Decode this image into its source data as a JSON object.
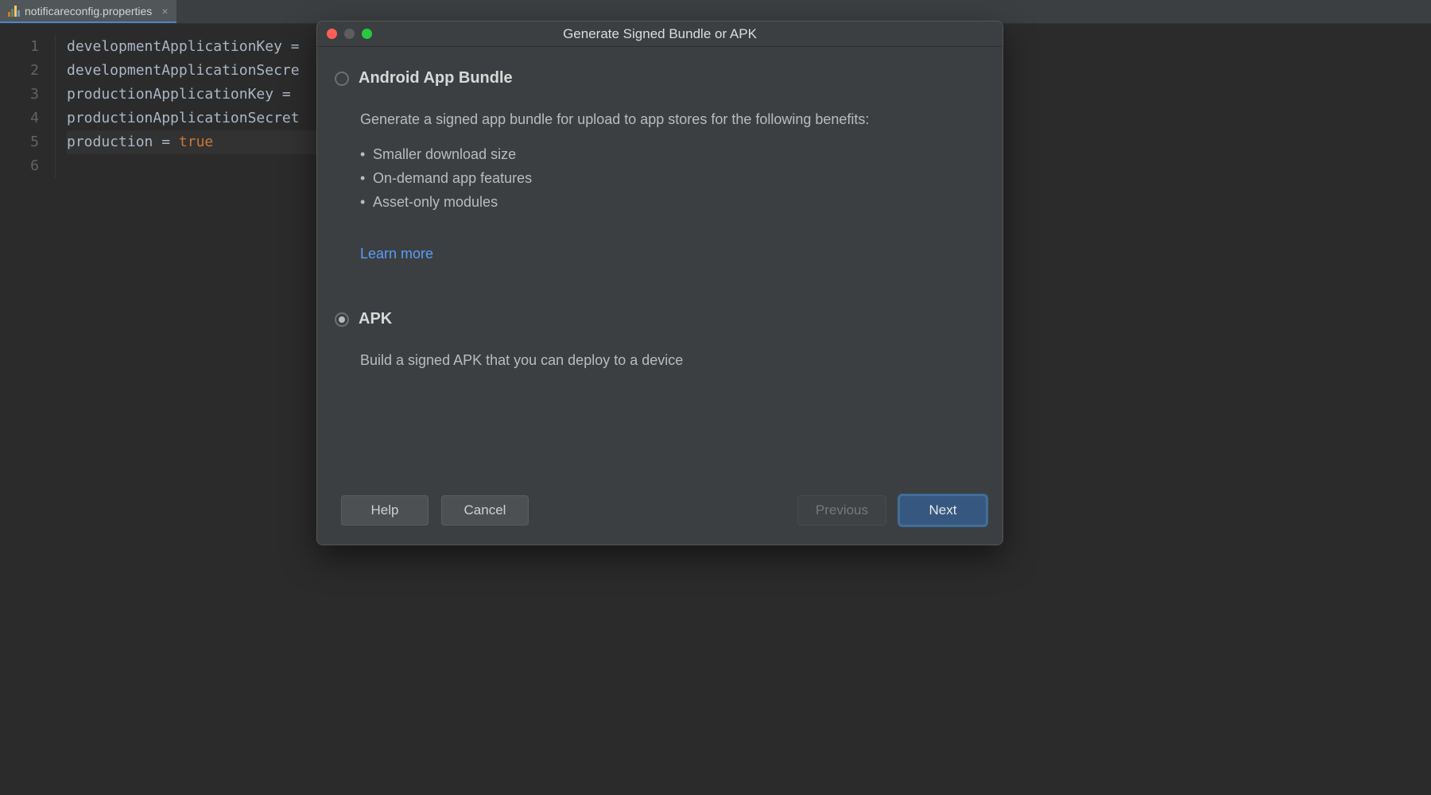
{
  "tab": {
    "filename": "notificareconfig.properties"
  },
  "editor": {
    "lines": [
      "developmentApplicationKey =",
      "developmentApplicationSecre",
      "productionApplicationKey =",
      "productionApplicationSecret",
      "production = ",
      ""
    ],
    "line5_value": "true",
    "line_numbers": [
      "1",
      "2",
      "3",
      "4",
      "5",
      "6"
    ]
  },
  "dialog": {
    "title": "Generate Signed Bundle or APK",
    "option_bundle": {
      "label": "Android App Bundle",
      "description": "Generate a signed app bundle for upload to app stores for the following benefits:",
      "bullets": [
        "Smaller download size",
        "On-demand app features",
        "Asset-only modules"
      ],
      "link": "Learn more"
    },
    "option_apk": {
      "label": "APK",
      "description": "Build a signed APK that you can deploy to a device"
    },
    "buttons": {
      "help": "Help",
      "cancel": "Cancel",
      "previous": "Previous",
      "next": "Next"
    }
  }
}
